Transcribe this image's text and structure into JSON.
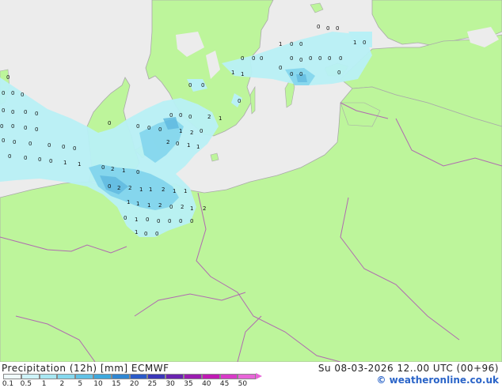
{
  "map": {
    "colors": {
      "land": "#bdf59b",
      "sea": "#ececec",
      "border": "#a9a9a9",
      "border_inner": "#b06bb0",
      "precip_light": "#b8f0f6",
      "precip_mid": "#7fd3ec",
      "precip_dark": "#5eb8de"
    },
    "values": [
      "0",
      "0",
      "0",
      "0",
      "0",
      "0",
      "0",
      "0",
      "0",
      "0",
      "0",
      "0",
      "0",
      "0",
      "0",
      "0",
      "0",
      "0",
      "0",
      "0",
      "0",
      "0",
      "1",
      "1",
      "0",
      "2",
      "1",
      "0",
      "0",
      "2",
      "2",
      "1",
      "1",
      "2",
      "1",
      "1",
      "1",
      "1",
      "1",
      "2",
      "0",
      "2",
      "1",
      "2",
      "0",
      "1",
      "0",
      "0",
      "0",
      "0",
      "0",
      "1",
      "0",
      "0",
      "0",
      "0",
      "0",
      "0",
      "0",
      "0",
      "0",
      "2",
      "1",
      "2",
      "0",
      "1",
      "1",
      "1",
      "2",
      "0",
      "0",
      "0",
      "0",
      "0",
      "0",
      "0",
      "1",
      "1",
      "1",
      "0",
      "0",
      "0",
      "0",
      "0",
      "1",
      "0",
      "0",
      "0",
      "0",
      "0",
      "0",
      "0",
      "0",
      "0",
      "0",
      "0"
    ]
  },
  "footer": {
    "title": "Precipitation (12h) [mm] ECMWF",
    "timestamp": "Su 08-03-2026 12..00 UTC (00+96)",
    "credit": "© weatheronline.co.uk",
    "legend_ticks": [
      "0.1",
      "0.5",
      "1",
      "2",
      "5",
      "10",
      "15",
      "20",
      "25",
      "30",
      "35",
      "40",
      "45",
      "50"
    ],
    "legend_colors": [
      "#f0fbfd",
      "#cdf3f8",
      "#a8e7f2",
      "#86d8ee",
      "#62c2e6",
      "#3ea8dc",
      "#2f86d2",
      "#2a5bc8",
      "#3a37b8",
      "#6a23b0",
      "#9a1cb0",
      "#c01ab4",
      "#d83ac8",
      "#e865d8"
    ]
  }
}
